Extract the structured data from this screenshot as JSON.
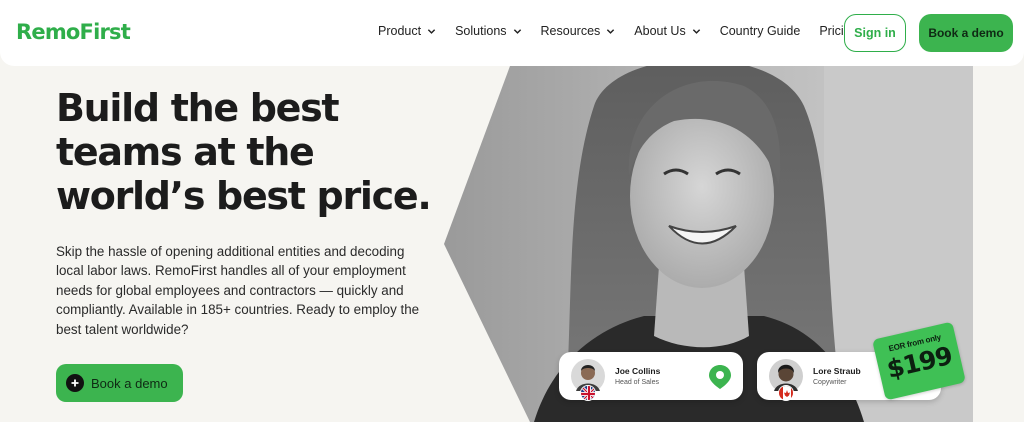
{
  "header": {
    "logo_text": "RemoFirst",
    "nav": [
      {
        "label": "Product",
        "has_dropdown": true
      },
      {
        "label": "Solutions",
        "has_dropdown": true
      },
      {
        "label": "Resources",
        "has_dropdown": true
      },
      {
        "label": "About Us",
        "has_dropdown": true
      },
      {
        "label": "Country Guide",
        "has_dropdown": false
      },
      {
        "label": "Pricing",
        "has_dropdown": false
      }
    ],
    "signin_label": "Sign in",
    "demo_label": "Book a demo"
  },
  "hero": {
    "title": "Build the best teams at the world’s best price.",
    "description": "Skip the hassle of opening additional entities and decoding local labor laws. RemoFirst handles all of your employment needs for global employees and contractors — quickly and compliantly. Available in 185+ countries. Ready to employ the best talent worldwide?",
    "cta_label": "Book a demo",
    "cta_icon": "plus-circle-icon"
  },
  "profiles": [
    {
      "name": "Joe Collins",
      "role": "Head of Sales",
      "flag": "uk-flag-icon"
    },
    {
      "name": "Lore Straub",
      "role": "Copywriter",
      "flag": "canada-flag-icon"
    }
  ],
  "badge": {
    "small_text": "EOR from only",
    "price": "$199"
  },
  "colors": {
    "brand_green": "#2fae4a",
    "button_green": "#3cb44f",
    "page_bg": "#f6f5f1"
  }
}
